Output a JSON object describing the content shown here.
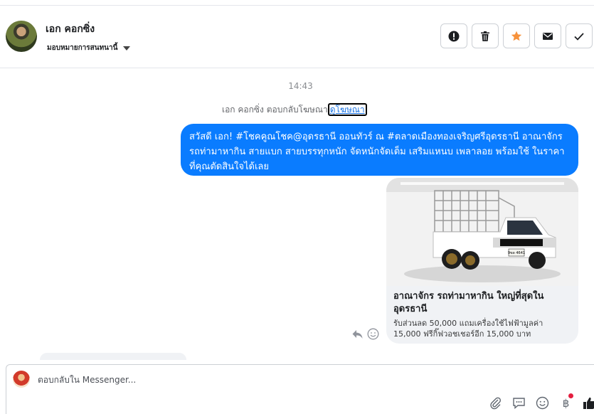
{
  "header": {
    "contact_name": "เอก คอกซิ่ง",
    "assign_label": "มอบหมายการสนทนานี้"
  },
  "thread": {
    "time": "14:43",
    "reply_note": "เอก คอกซิ่ง ตอบกลับโฆษณา",
    "ad_link": "ดูโฆษณา",
    "message": "สวัสดี เอก! #โชคคูณโชค@อุดรธานี ออนทัวร์ ณ #ตลาดเมืองทองเจริญศรีอุดรธานี อาณาจักร รถท่ามาหากิน สายแบก สายบรรทุกหนัก จัดหนักจัดเต็ม เสริมแหนบ เพลาลอย พร้อมใช้ ในราคาที่คุณตัดสินใจได้เลย",
    "card": {
      "plate_text": "9ขด 4641",
      "title": "อาณาจักร รถท่ามาหากิน ใหญ่ที่สุดใน อุดรธานี",
      "subtitle": "รับส่วนลด 50,000 แถมเครื่องใช้ไฟฟ้ามูลค่า 15,000 ฟรีกิ๊ฟวอชเชอร์อีก 15,000 บาท"
    }
  },
  "composer": {
    "placeholder": "ตอบกลับใน Messenger..."
  },
  "icons": {
    "header_actions": [
      "alert-icon",
      "trash-icon",
      "star-icon",
      "mail-icon",
      "check-icon"
    ],
    "composer": [
      "attach-icon",
      "saved-reply-icon",
      "emoji-icon",
      "baht-icon",
      "like-icon"
    ]
  },
  "colors": {
    "bubble": "#0a7cff",
    "star": "#f7923b",
    "like": "#1c1e21",
    "notification": "#e41e3f"
  }
}
